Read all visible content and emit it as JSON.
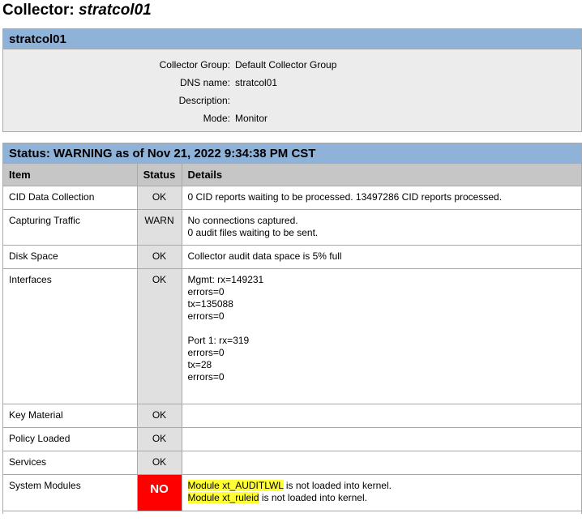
{
  "page": {
    "title_prefix": "Collector: ",
    "title_name": "stratcol01"
  },
  "info": {
    "header": "stratcol01",
    "rows": [
      {
        "label": "Collector Group:",
        "value": "Default Collector Group"
      },
      {
        "label": "DNS name:",
        "value": "stratcol01"
      },
      {
        "label": "Description:",
        "value": ""
      },
      {
        "label": "Mode:",
        "value": "Monitor"
      }
    ]
  },
  "status": {
    "header": "Status: WARNING as of Nov 21, 2022 9:34:38 PM CST",
    "columns": {
      "item": "Item",
      "status": "Status",
      "details": "Details"
    },
    "rows": [
      {
        "item": "CID Data Collection",
        "status": "OK",
        "details": [
          "0 CID reports waiting to be processed. 13497286 CID reports processed."
        ]
      },
      {
        "item": "Capturing Traffic",
        "status": "WARN",
        "details": [
          "No connections captured.",
          "0 audit files waiting to be sent."
        ]
      },
      {
        "item": "Disk Space",
        "status": "OK",
        "details": [
          "Collector audit data space is 5% full"
        ]
      },
      {
        "item": "Interfaces",
        "status": "OK",
        "details": [
          "Mgmt: rx=149231",
          "errors=0",
          "tx=135088",
          "errors=0",
          "",
          "Port 1: rx=319",
          "errors=0",
          "tx=28",
          "errors=0"
        ]
      },
      {
        "item": "Key Material",
        "status": "OK",
        "details": []
      },
      {
        "item": "Policy Loaded",
        "status": "OK",
        "details": []
      },
      {
        "item": "Services",
        "status": "OK",
        "details": []
      },
      {
        "item": "System Modules",
        "status": "NO",
        "details_highlighted": [
          {
            "hl": "Module xt_AUDITLWL",
            "rest": " is not loaded into kernel."
          },
          {
            "hl": "Module xt_ruleid",
            "rest": " is not loaded into kernel."
          }
        ]
      }
    ]
  },
  "colors": {
    "header_blue": "#8fb2d9",
    "info_bg": "#ececec",
    "status_no": "#ff0000",
    "highlight": "#ffff33"
  }
}
